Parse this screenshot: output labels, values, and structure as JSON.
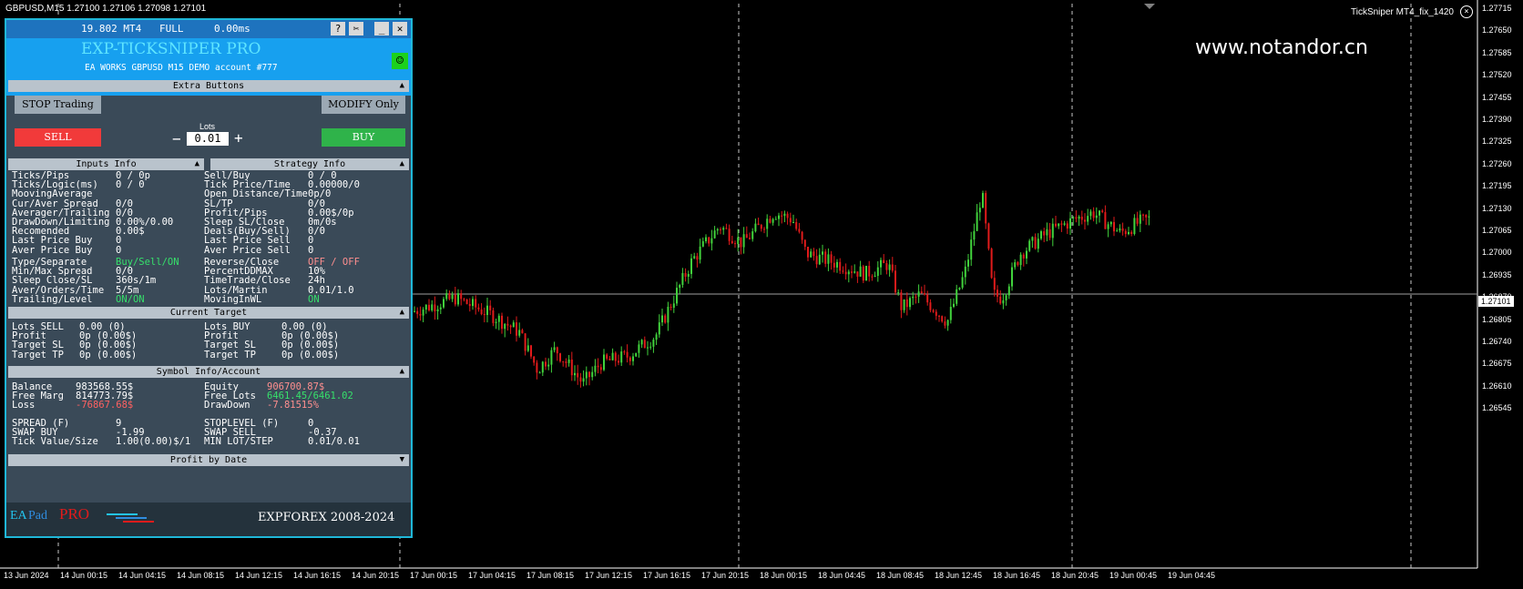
{
  "chart": {
    "title": "GBPUSD,M15  1.27100 1.27106 1.27098 1.27101",
    "indicator_label": "TickSniper MT4_fix_1420",
    "close_icon": "close-circle-icon",
    "watermark": "www.notandor.cn",
    "current_price": "1.27101",
    "price_ticks": [
      "1.27715",
      "1.27650",
      "1.27585",
      "1.27520",
      "1.27455",
      "1.27390",
      "1.27325",
      "1.27260",
      "1.27195",
      "1.27130",
      "1.27065",
      "1.27000",
      "1.26935",
      "1.26870",
      "1.26805",
      "1.26740",
      "1.26675",
      "1.26610",
      "1.26545"
    ],
    "time_ticks": [
      "13 Jun 2024",
      "14 Jun 00:15",
      "14 Jun 04:15",
      "14 Jun 08:15",
      "14 Jun 12:15",
      "14 Jun 16:15",
      "14 Jun 20:15",
      "17 Jun 00:15",
      "17 Jun 04:15",
      "17 Jun 08:15",
      "17 Jun 12:15",
      "17 Jun 16:15",
      "17 Jun 20:15",
      "18 Jun 00:15",
      "18 Jun 04:45",
      "18 Jun 08:45",
      "18 Jun 12:45",
      "18 Jun 16:45",
      "18 Jun 20:45",
      "19 Jun 00:45",
      "19 Jun 04:45"
    ],
    "colors": {
      "bull": "#41d23c",
      "bear": "#e11b1b",
      "grid": "#c8c8c8",
      "bg": "#000000"
    }
  },
  "panel": {
    "topbar": {
      "version": "19.802 MT4",
      "mode": "FULL",
      "latency": "0.00ms",
      "help": "?",
      "tools": "✂",
      "minimize": "_",
      "close": "✕"
    },
    "title": "EXP-TICKSNIPER PRO",
    "subtitle": "EA WORKS GBPUSD  M15 DEMO account   #777",
    "smiley": "☺",
    "extra_buttons": {
      "header": "Extra Buttons",
      "stop": "STOP Trading",
      "modify": "MODIFY Only",
      "sell": "SELL",
      "buy": "BUY",
      "lots_label": "Lots",
      "lots_value": "0.01",
      "minus": "−",
      "plus": "+"
    },
    "inputs_info": {
      "header": "Inputs Info",
      "rows": [
        [
          "Ticks/Pips",
          "0 / 0p"
        ],
        [
          "Ticks/Logic(ms)",
          "0 / 0"
        ],
        [
          "MoovingAverage",
          ""
        ],
        [
          "Cur/Aver Spread",
          "0/0"
        ],
        [
          "Averager/Trailing",
          "0/0"
        ],
        [
          "DrawDown/Limiting",
          "0.00%/0.00"
        ],
        [
          "Recomended",
          "0.00$"
        ],
        [
          "Last Price Buy",
          "0"
        ],
        [
          "Aver Price Buy",
          "0"
        ]
      ],
      "rows2": [
        [
          "Type/Separate",
          "Buy/Sell/ON"
        ],
        [
          "Min/Max Spread",
          "0/0"
        ],
        [
          "Sleep Close/SL",
          "360s/1m"
        ],
        [
          "Aver/Orders/Time",
          "5/5m"
        ],
        [
          "Trailing/Level",
          "ON/ON"
        ]
      ]
    },
    "strategy_info": {
      "header": "Strategy Info",
      "rows": [
        [
          "Sell/Buy",
          "0 / 0"
        ],
        [
          "Tick Price/Time",
          "0.00000/0"
        ],
        [
          "Open Distance/Time",
          "0p/0"
        ],
        [
          "SL/TP",
          "0/0"
        ],
        [
          "Profit/Pips",
          "0.00$/0p"
        ],
        [
          "Sleep SL/Close",
          "0m/0s"
        ],
        [
          "Deals(Buy/Sell)",
          "0/0"
        ],
        [
          "Last Price Sell",
          "0"
        ],
        [
          "Aver Price Sell",
          "0"
        ]
      ],
      "rows2": [
        [
          "Reverse/Close",
          "OFF / OFF"
        ],
        [
          "PercentDDMAX",
          "10%"
        ],
        [
          "TimeTrade/Close",
          "24h"
        ],
        [
          "Lots/Martin",
          "0.01/1.0"
        ],
        [
          "MovingInWL",
          "ON"
        ]
      ]
    },
    "current_target": {
      "header": "Current Target",
      "left": [
        [
          "Lots SELL",
          "0.00 (0)"
        ],
        [
          "Profit",
          "0p (0.00$)"
        ],
        [
          "Target SL",
          "0p (0.00$)"
        ],
        [
          "Target TP",
          "0p (0.00$)"
        ]
      ],
      "right": [
        [
          "Lots BUY",
          "0.00 (0)"
        ],
        [
          "Profit",
          "0p (0.00$)"
        ],
        [
          "Target SL",
          "0p (0.00$)"
        ],
        [
          "Target TP",
          "0p (0.00$)"
        ]
      ]
    },
    "symbol_info": {
      "header": "Symbol Info/Account",
      "left": [
        [
          "Balance",
          "983568.55$"
        ],
        [
          "Free Marg",
          "814773.79$"
        ],
        [
          "Loss",
          "-76867.68$"
        ]
      ],
      "right": [
        [
          "Equity",
          "906700.87$"
        ],
        [
          "Free Lots",
          "6461.45/6461.02"
        ],
        [
          "DrawDown",
          "-7.81515%"
        ]
      ],
      "left2": [
        [
          "SPREAD (F)",
          "9"
        ],
        [
          "SWAP BUY",
          "-1.99"
        ],
        [
          "Tick Value/Size",
          "1.00(0.00)$/1"
        ]
      ],
      "right2": [
        [
          "STOPLEVEL (F)",
          "0"
        ],
        [
          "SWAP SELL",
          "-0.37"
        ],
        [
          "MIN LOT/STEP",
          "0.01/0.01"
        ]
      ]
    },
    "profit_by_date": {
      "header": "Profit by Date"
    },
    "footer": {
      "brand_ea": "EA",
      "brand_pad": "Pad",
      "brand_pro": "PRO",
      "copyright": "EXPFOREX 2008-2024"
    }
  }
}
